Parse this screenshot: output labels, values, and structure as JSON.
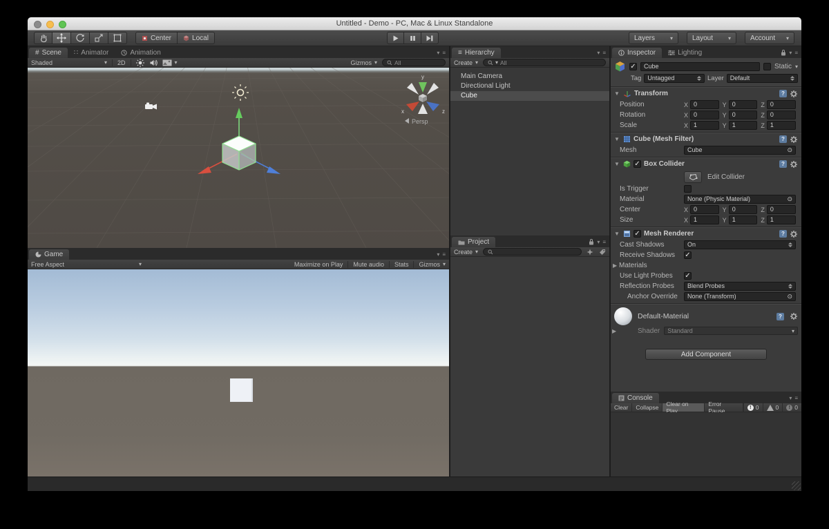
{
  "window": {
    "title": "Untitled - Demo - PC, Mac & Linux Standalone"
  },
  "icons": {
    "chevron_down": "▾",
    "menu_lines": "≡",
    "check": "✓",
    "target": "⊙",
    "foldout_open": "▼",
    "foldout_closed": "▶",
    "scene_hash": "#",
    "animator_glyph": "∷",
    "hierarchy_glyph": "≡",
    "help": "?"
  },
  "toolbar": {
    "pivot_center": "Center",
    "pivot_local": "Local",
    "layers": "Layers",
    "layout": "Layout",
    "account": "Account"
  },
  "scene": {
    "tab": "Scene",
    "tab_animator": "Animator",
    "tab_animation": "Animation",
    "render_mode": "Shaded",
    "btn_2d": "2D",
    "gizmos": "Gizmos",
    "search_value": "All",
    "persp_label": "Persp",
    "axis": {
      "x": "x",
      "y": "y",
      "z": "z"
    }
  },
  "game": {
    "tab": "Game",
    "aspect": "Free Aspect",
    "maximize_on_play": "Maximize on Play",
    "mute_audio": "Mute audio",
    "stats": "Stats",
    "gizmos": "Gizmos"
  },
  "hierarchy": {
    "tab": "Hierarchy",
    "create_label": "Create",
    "search_value": "All",
    "items": [
      "Main Camera",
      "Directional Light",
      "Cube"
    ]
  },
  "project": {
    "tab": "Project",
    "create_label": "Create"
  },
  "inspector": {
    "tab": "Inspector",
    "tab_lighting": "Lighting",
    "header": {
      "name": "Cube",
      "static_label": "Static",
      "tag_label": "Tag",
      "tag_value": "Untagged",
      "layer_label": "Layer",
      "layer_value": "Default"
    },
    "axis": {
      "x": "X",
      "y": "Y",
      "z": "Z"
    },
    "transform": {
      "title": "Transform",
      "position_label": "Position",
      "rotation_label": "Rotation",
      "scale_label": "Scale",
      "position": {
        "x": "0",
        "y": "0",
        "z": "0"
      },
      "rotation": {
        "x": "0",
        "y": "0",
        "z": "0"
      },
      "scale": {
        "x": "1",
        "y": "1",
        "z": "1"
      }
    },
    "mesh_filter": {
      "title": "Cube (Mesh Filter)",
      "mesh_label": "Mesh",
      "mesh_value": "Cube"
    },
    "box_collider": {
      "title": "Box Collider",
      "edit_collider": "Edit Collider",
      "is_trigger_label": "Is Trigger",
      "material_label": "Material",
      "material_value": "None (Physic Material)",
      "center_label": "Center",
      "center": {
        "x": "0",
        "y": "0",
        "z": "0"
      },
      "size_label": "Size",
      "size": {
        "x": "1",
        "y": "1",
        "z": "1"
      }
    },
    "mesh_renderer": {
      "title": "Mesh Renderer",
      "cast_shadows_label": "Cast Shadows",
      "cast_shadows_value": "On",
      "receive_shadows_label": "Receive Shadows",
      "materials_label": "Materials",
      "use_light_probes_label": "Use Light Probes",
      "reflection_probes_label": "Reflection Probes",
      "reflection_probes_value": "Blend Probes",
      "anchor_override_label": "Anchor Override",
      "anchor_override_value": "None (Transform)"
    },
    "material": {
      "name": "Default-Material",
      "shader_label": "Shader",
      "shader_value": "Standard"
    },
    "add_component": "Add Component"
  },
  "console": {
    "tab": "Console",
    "clear": "Clear",
    "collapse": "Collapse",
    "clear_on_play": "Clear on Play",
    "error_pause": "Error Pause",
    "info_count": "0",
    "warning_count": "0",
    "error_count": "0"
  }
}
